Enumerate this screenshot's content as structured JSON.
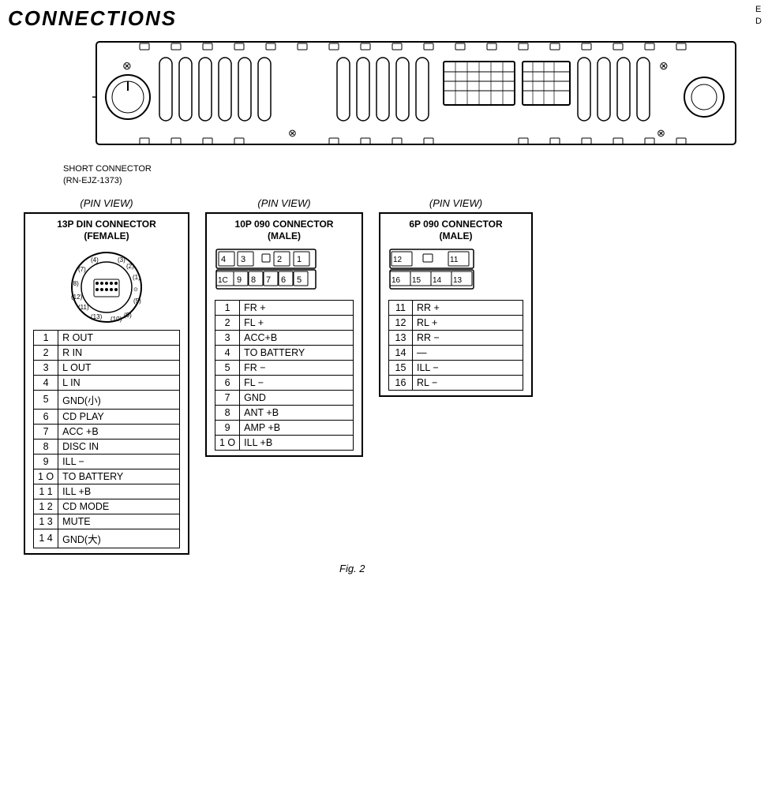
{
  "header": {
    "title": "CONNECTIONS"
  },
  "corner_marks": [
    "E",
    "D"
  ],
  "short_connector_label": "SHORT CONNECTOR\n(RN-EJZ-1373)",
  "fig_label": "Fig. 2",
  "pin_blocks": [
    {
      "id": "block-13p",
      "pin_view_label": "(PIN  VIEW)",
      "connector_title": "13P DIN CONNECTOR\n(FEMALE)",
      "has_circular": true,
      "pins": [
        {
          "num": "1",
          "label": "R OUT"
        },
        {
          "num": "2",
          "label": "R IN"
        },
        {
          "num": "3",
          "label": "L OUT"
        },
        {
          "num": "4",
          "label": "L IN"
        },
        {
          "num": "5",
          "label": "GND(小)"
        },
        {
          "num": "6",
          "label": "CD PLAY"
        },
        {
          "num": "7",
          "label": "ACC +B"
        },
        {
          "num": "8",
          "label": "DISC IN"
        },
        {
          "num": "9",
          "label": "ILL −"
        },
        {
          "num": "1 O",
          "label": "TO BATTERY"
        },
        {
          "num": "1 1",
          "label": "ILL +B"
        },
        {
          "num": "1 2",
          "label": "CD MODE"
        },
        {
          "num": "1 3",
          "label": "MUTE"
        },
        {
          "num": "1 4",
          "label": "GND(大)"
        }
      ]
    },
    {
      "id": "block-10p",
      "pin_view_label": "(PIN  VIEW)",
      "connector_title": "10P 090 CONNECTOR\n(MALE)",
      "has_grid": true,
      "grid_type": "10p",
      "grid_top": [
        "4",
        "3",
        "",
        "2",
        "1"
      ],
      "grid_bottom": [
        "1C",
        "9",
        "8",
        "7",
        "6",
        "5"
      ],
      "pins": [
        {
          "num": "1",
          "label": "FR +"
        },
        {
          "num": "2",
          "label": "FL +"
        },
        {
          "num": "3",
          "label": "ACC+B"
        },
        {
          "num": "4",
          "label": "TO BATTERY"
        },
        {
          "num": "5",
          "label": "FR −"
        },
        {
          "num": "6",
          "label": "FL −"
        },
        {
          "num": "7",
          "label": "GND"
        },
        {
          "num": "8",
          "label": "ANT +B"
        },
        {
          "num": "9",
          "label": "AMP +B"
        },
        {
          "num": "1 O",
          "label": "ILL +B"
        }
      ]
    },
    {
      "id": "block-6p",
      "pin_view_label": "(PIN  VIEW)",
      "connector_title": "6P 090 CONNECTOR\n(MALE)",
      "has_grid": true,
      "grid_type": "6p",
      "grid_top": [
        "12",
        "",
        "11"
      ],
      "grid_bottom": [
        "16",
        "15",
        "14",
        "13"
      ],
      "pins": [
        {
          "num": "11",
          "label": "RR +"
        },
        {
          "num": "12",
          "label": "RL +"
        },
        {
          "num": "13",
          "label": "RR −"
        },
        {
          "num": "14",
          "label": "—"
        },
        {
          "num": "15",
          "label": "ILL −"
        },
        {
          "num": "16",
          "label": "RL −"
        }
      ]
    }
  ]
}
